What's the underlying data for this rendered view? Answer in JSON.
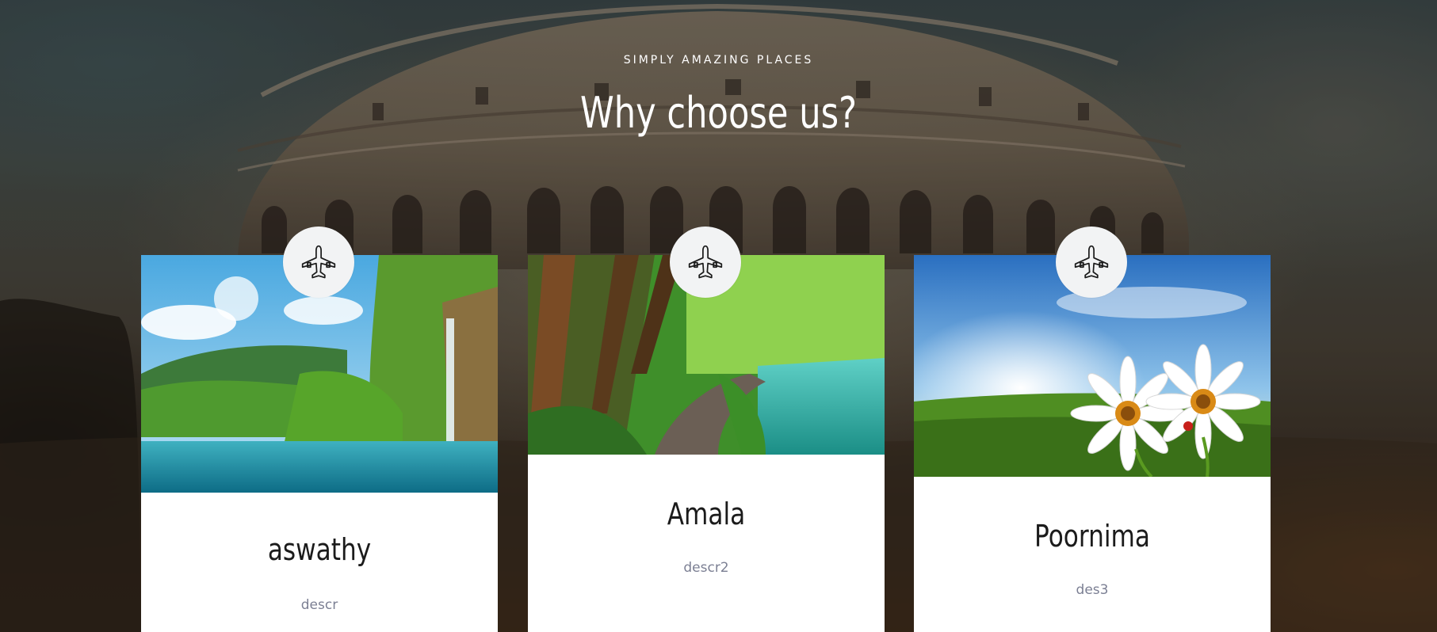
{
  "section": {
    "eyebrow": "SIMPLY AMAZING PLACES",
    "heading": "Why choose us?"
  },
  "colors": {
    "card_background": "#ffffff",
    "title_color": "#1b1b1b",
    "desc_color": "#7b7f93",
    "badge_background": "#f2f3f4"
  },
  "cards": [
    {
      "title": "aswathy",
      "description": "descr",
      "icon": "airplane-icon",
      "image_alt": "waterfall-lake-landscape"
    },
    {
      "title": "Amala",
      "description": "descr2",
      "icon": "airplane-icon",
      "image_alt": "forest-path-by-lake"
    },
    {
      "title": "Poornima",
      "description": "des3",
      "icon": "airplane-icon",
      "image_alt": "daisies-on-meadow"
    }
  ]
}
